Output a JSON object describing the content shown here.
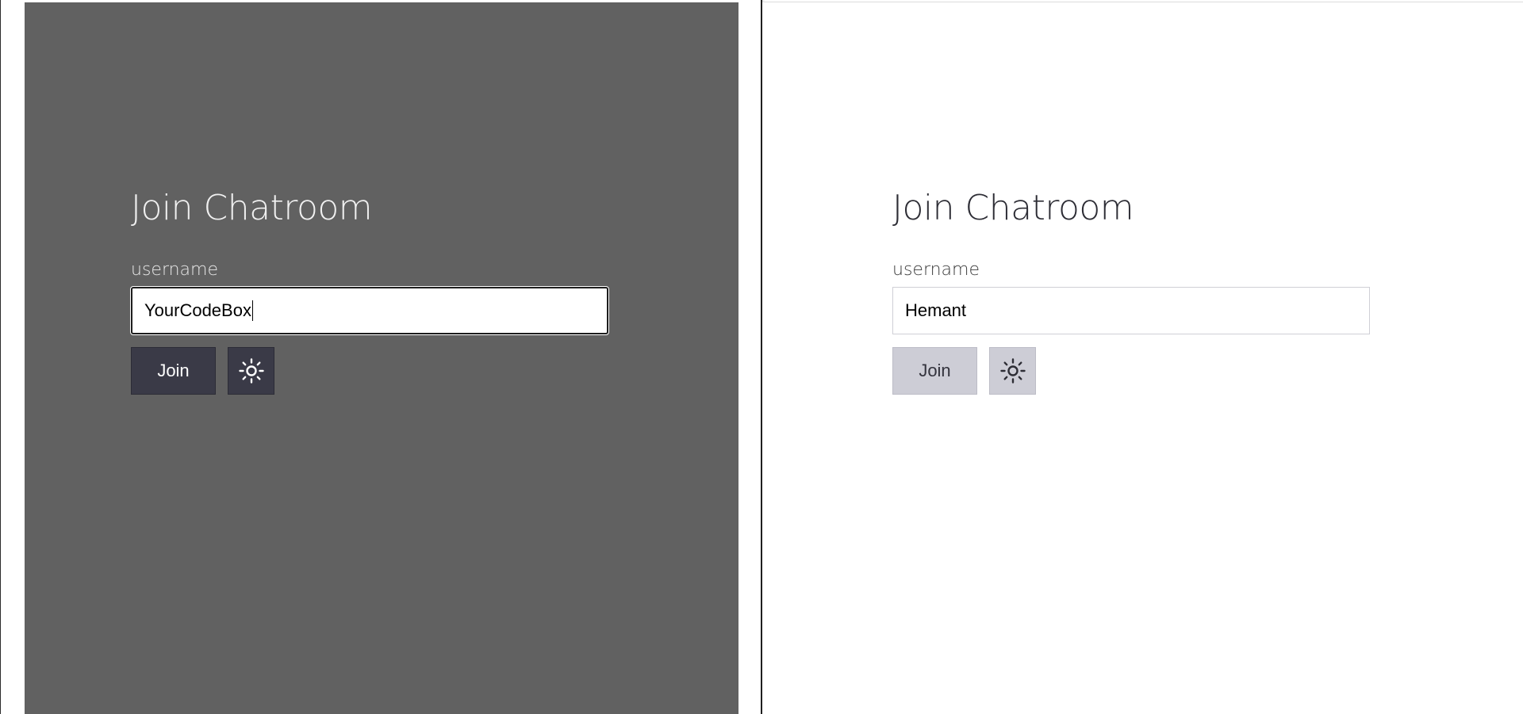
{
  "colors": {
    "dark_pane_bg": "#616161",
    "dark_button_bg": "#3a3a47",
    "light_button_bg": "#cdcdd6",
    "light_pane_bg": "#ffffff"
  },
  "dark_pane": {
    "title": "Join Chatroom",
    "username_label": "username",
    "username_value": "YourCodeBox",
    "join_label": "Join",
    "theme_icon": "sun-icon"
  },
  "light_pane": {
    "title": "Join Chatroom",
    "username_label": "username",
    "username_value": "Hemant",
    "join_label": "Join",
    "theme_icon": "sun-icon"
  }
}
